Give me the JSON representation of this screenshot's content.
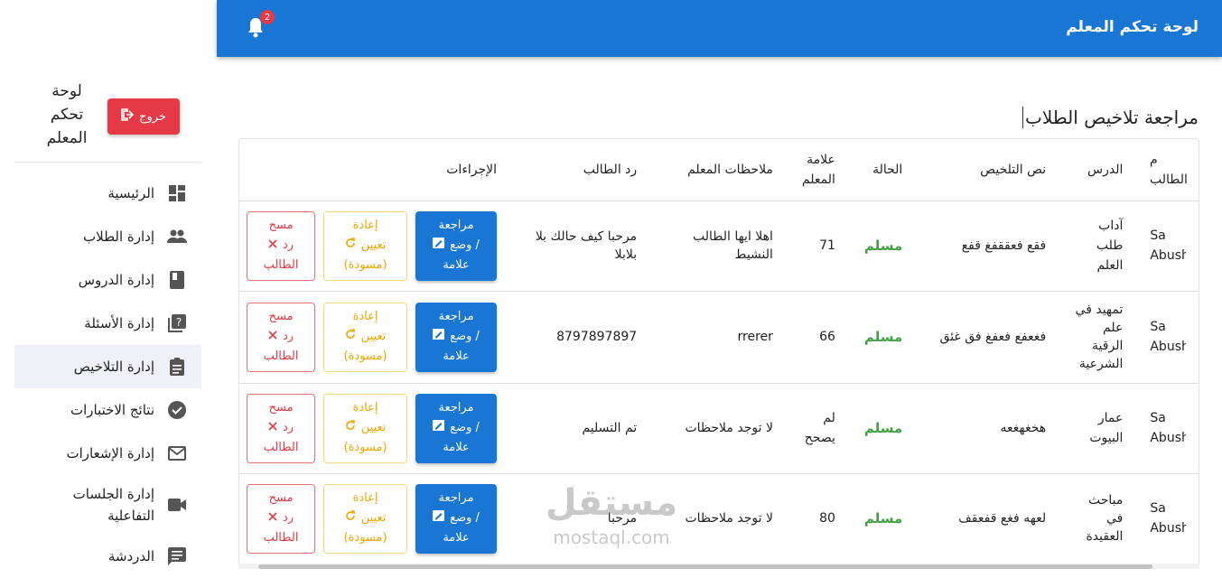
{
  "topbar": {
    "title": "لوحة تحكم المعلم",
    "notification_count": "2"
  },
  "sidebar": {
    "title": "لوحة تحكم المعلم",
    "logout_label": "خروج",
    "items": [
      {
        "label": "الرئيسية",
        "icon": "dashboard-icon"
      },
      {
        "label": "إدارة الطلاب",
        "icon": "people-icon"
      },
      {
        "label": "إدارة الدروس",
        "icon": "book-icon"
      },
      {
        "label": "إدارة الأسئلة",
        "icon": "quiz-icon"
      },
      {
        "label": "إدارة التلاخيص",
        "icon": "clipboard-icon",
        "active": true
      },
      {
        "label": "نتائج الاختبارات",
        "icon": "check-circle-icon"
      },
      {
        "label": "إدارة الإشعارات",
        "icon": "mail-icon"
      },
      {
        "label": "إدارة الجلسات التفاعلية",
        "icon": "video-icon"
      },
      {
        "label": "الدردشة",
        "icon": "chat-icon"
      }
    ]
  },
  "main": {
    "page_title": "مراجعة تلاخيص الطلاب",
    "columns": [
      "م الطالب",
      "الدرس",
      "نص التلخيص",
      "الحالة",
      "علامة المعلم",
      "ملاحظات المعلم",
      "رد الطالب",
      "الإجراءات"
    ],
    "rows": [
      {
        "student": "Sa Abushi",
        "lesson": "آداب طلب العلم",
        "summary": "فقع فعققفغ قفع",
        "status": "مسلم",
        "grade": "71",
        "notes": "اهلا ايها الطالب النشيط",
        "reply": "مرحبا كيف حالك بلا بلابلا"
      },
      {
        "student": "Sa Abushi",
        "lesson": "تمهيد في علم الرقية الشرعية",
        "summary": "فغعفع فعفغ فق غئق",
        "status": "مسلم",
        "grade": "66",
        "notes": "rrerer",
        "reply": "8797897897"
      },
      {
        "student": "Sa Abushi",
        "lesson": "عمار البيوت",
        "summary": "هخغهغعه",
        "status": "مسلم",
        "grade": "لم يصحح",
        "notes": "لا توجد ملاحظات",
        "reply": "تم التسليم"
      },
      {
        "student": "Sa Abushi",
        "lesson": "مباحث في العقيدة",
        "summary": "لعهه فغع قفعقف",
        "status": "مسلم",
        "grade": "80",
        "notes": "لا توجد ملاحظات",
        "reply": "مرحبا"
      }
    ],
    "actions": {
      "review_top": "مراجعة",
      "review_bottom": "/ وضع",
      "review_last": "علامة",
      "reassign_top": "إعادة",
      "reassign_mid": "تعيين",
      "reassign_last": "(مسودة)",
      "clear_top": "مسح",
      "clear_mid": "رد",
      "clear_last": "الطالب"
    }
  },
  "watermark": {
    "brand_ar": "مستقل",
    "brand_en": "mostaql.com"
  }
}
